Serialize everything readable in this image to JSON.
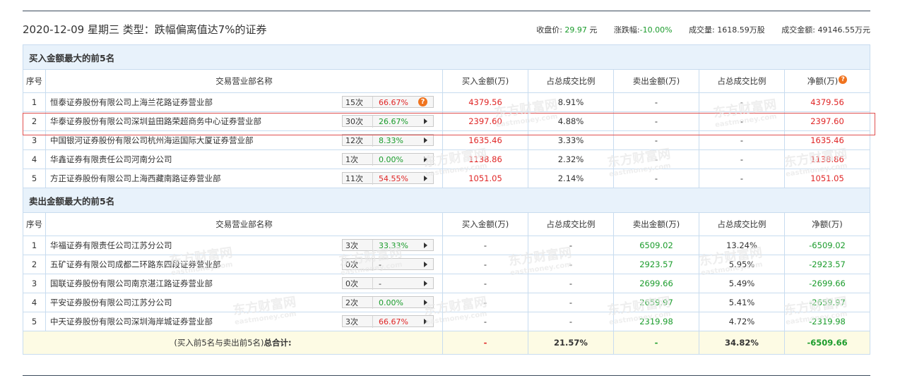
{
  "header": {
    "title": "2020-12-09 星期三 类型：跌幅偏离值达7%的证券",
    "close_label": "收盘价:",
    "close_value": "29.97",
    "close_unit": "元",
    "change_label": "涨跌幅:",
    "change_value": "-10.00%",
    "volume_label": "成交量:",
    "volume_value": "1618.59万股",
    "amount_label": "成交金额:",
    "amount_value": "49146.55万元"
  },
  "buy_section": {
    "title": "买入金额最大的前5名",
    "columns": [
      "序号",
      "交易营业部名称",
      "买入金额(万)",
      "占总成交比例",
      "卖出金额(万)",
      "占总成交比例",
      "净额(万)"
    ],
    "rows": [
      {
        "no": "1",
        "name": "恒泰证券股份有限公司上海兰花路证券营业部",
        "count": "15次",
        "pct": "66.67%",
        "buy": "4379.56",
        "buy_ratio": "8.91%",
        "sell": "-",
        "sell_ratio": "-",
        "net": "4379.56"
      },
      {
        "no": "2",
        "name": "华泰证券股份有限公司深圳益田路荣超商务中心证券营业部",
        "count": "30次",
        "pct": "26.67%",
        "buy": "2397.60",
        "buy_ratio": "4.88%",
        "sell": "-",
        "sell_ratio": "-",
        "net": "2397.60"
      },
      {
        "no": "3",
        "name": "中国银河证券股份有限公司杭州海运国际大厦证券营业部",
        "count": "12次",
        "pct": "8.33%",
        "buy": "1635.46",
        "buy_ratio": "3.33%",
        "sell": "-",
        "sell_ratio": "-",
        "net": "1635.46"
      },
      {
        "no": "4",
        "name": "华鑫证券有限责任公司河南分公司",
        "count": "1次",
        "pct": "0.00%",
        "buy": "1138.86",
        "buy_ratio": "2.32%",
        "sell": "-",
        "sell_ratio": "-",
        "net": "1138.86"
      },
      {
        "no": "5",
        "name": "方正证券股份有限公司上海西藏南路证券营业部",
        "count": "11次",
        "pct": "54.55%",
        "buy": "1051.05",
        "buy_ratio": "2.14%",
        "sell": "-",
        "sell_ratio": "-",
        "net": "1051.05"
      }
    ]
  },
  "sell_section": {
    "title": "卖出金额最大的前5名",
    "columns": [
      "序号",
      "交易营业部名称",
      "买入金额(万)",
      "占总成交比例",
      "卖出金额(万)",
      "占总成交比例",
      "净额(万)"
    ],
    "rows": [
      {
        "no": "1",
        "name": "华福证券有限责任公司江苏分公司",
        "count": "3次",
        "pct": "33.33%",
        "buy": "-",
        "buy_ratio": "-",
        "sell": "6509.02",
        "sell_ratio": "13.24%",
        "net": "-6509.02"
      },
      {
        "no": "2",
        "name": "五矿证券有限公司成都二环路东四段证券营业部",
        "count": "0次",
        "pct": "-",
        "buy": "-",
        "buy_ratio": "-",
        "sell": "2923.57",
        "sell_ratio": "5.95%",
        "net": "-2923.57"
      },
      {
        "no": "3",
        "name": "国联证券股份有限公司南京湛江路证券营业部",
        "count": "0次",
        "pct": "-",
        "buy": "-",
        "buy_ratio": "-",
        "sell": "2699.66",
        "sell_ratio": "5.49%",
        "net": "-2699.66"
      },
      {
        "no": "4",
        "name": "平安证券股份有限公司江苏分公司",
        "count": "2次",
        "pct": "0.00%",
        "buy": "-",
        "buy_ratio": "-",
        "sell": "2659.97",
        "sell_ratio": "5.41%",
        "net": "-2659.97"
      },
      {
        "no": "5",
        "name": "中天证券股份有限公司深圳海岸城证券营业部",
        "count": "3次",
        "pct": "66.67%",
        "buy": "-",
        "buy_ratio": "-",
        "sell": "2319.98",
        "sell_ratio": "4.72%",
        "net": "-2319.98"
      }
    ]
  },
  "summary": {
    "label_prefix": "(买入前5名与卖出前5名)",
    "label_bold": "总合计:",
    "buy": "-",
    "buy_ratio": "21.57%",
    "sell": "-",
    "sell_ratio": "34.82%",
    "net": "-6509.66"
  },
  "watermark": {
    "text_cn": "东方财富网",
    "text_en": "eastmoney.com"
  },
  "colors": {
    "red": "#e02626",
    "green": "#1b9c2c",
    "section_bg": "#e8f2fb",
    "border": "#c8dcef",
    "summary_bg": "#fdfbe4"
  }
}
